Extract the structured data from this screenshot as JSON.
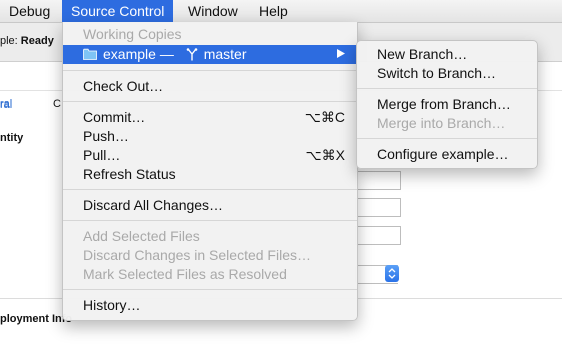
{
  "menubar": {
    "items": [
      {
        "label": "Debug"
      },
      {
        "label": "Source Control"
      },
      {
        "label": "Window"
      },
      {
        "label": "Help"
      }
    ]
  },
  "background": {
    "status_prefix": "ple: ",
    "status_value": "Ready",
    "tab_general": "ral",
    "tab_other": "C",
    "section_identity": "ntity",
    "section_deployment": "ployment Info"
  },
  "source_control_menu": {
    "header": "Working Copies",
    "working_copy": {
      "project": "example",
      "dash": "—",
      "branch": "master"
    },
    "check_out": "Check Out…",
    "commit": {
      "label": "Commit…",
      "shortcut": "⌥⌘C"
    },
    "push": "Push…",
    "pull": {
      "label": "Pull…",
      "shortcut": "⌥⌘X"
    },
    "refresh": "Refresh Status",
    "discard_all": "Discard All Changes…",
    "add_selected": "Add Selected Files",
    "discard_selected": "Discard Changes in Selected Files…",
    "mark_resolved": "Mark Selected Files as Resolved",
    "history": "History…"
  },
  "branch_submenu": {
    "new_branch": "New Branch…",
    "switch_branch": "Switch to Branch…",
    "merge_from": "Merge from Branch…",
    "merge_into": "Merge into Branch…",
    "configure": "Configure example…"
  },
  "colors": {
    "highlight": "#2d6ce0",
    "disabled_text": "#a9a9a9",
    "link_blue": "#2a6bd0"
  }
}
